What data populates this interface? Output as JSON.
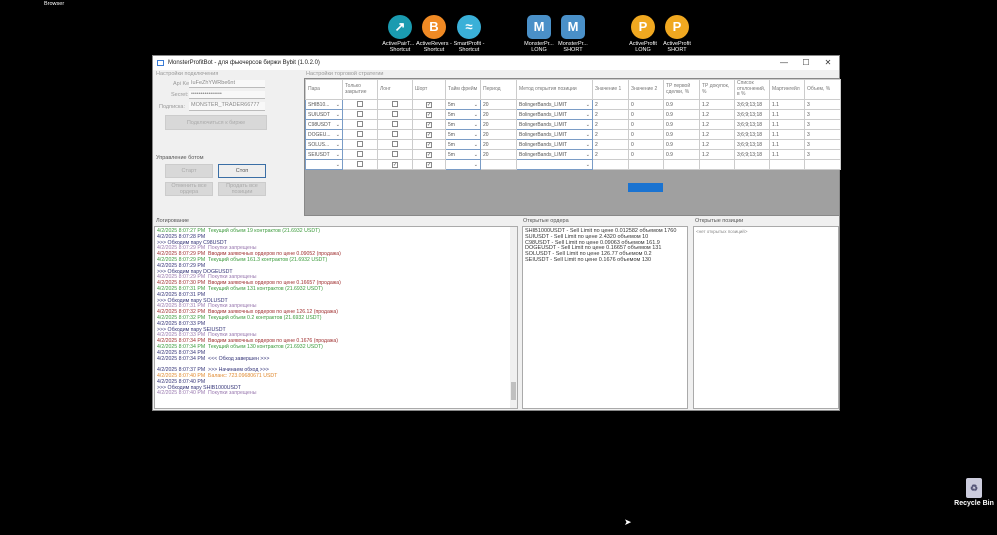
{
  "desktop": {
    "browser_label": "Browser",
    "icons": [
      {
        "label": "ActivePairT... - Shortcut",
        "color": "#1a9bb0",
        "glyph": "↗"
      },
      {
        "label": "ActiveRevers - Shortcut",
        "color": "#f08a24",
        "glyph": "B"
      },
      {
        "label": "SmartProfit - Shortcut",
        "color": "#3ab0d8",
        "glyph": "≈"
      },
      {
        "label": "MonsterPr... LONG",
        "color": "#4a90c8",
        "glyph": "M"
      },
      {
        "label": "MonsterPr... SHORT",
        "color": "#4a90c8",
        "glyph": "M"
      },
      {
        "label": "ActiveProfit LONG",
        "color": "#f0a820",
        "glyph": "P"
      },
      {
        "label": "ActiveProfit SHORT",
        "color": "#f0a820",
        "glyph": "P"
      }
    ],
    "recycle_bin": "Recycle Bin"
  },
  "window": {
    "title": "MonsterProfitBot - для фьючерсов биржи Bybit (1.0.2.0)",
    "minimize": "—",
    "maximize": "☐",
    "close": "✕"
  },
  "connection": {
    "group": "Настройки подключения",
    "api_key_label": "Api Key:",
    "api_key": "IuFeZhYWRbe6nt",
    "secret_label": "Secret:",
    "secret": "••••••••••••••••",
    "subscription_label": "Подписка:",
    "subscription": "MONSTER_TRADER66777",
    "connect_button": "Подключиться к бирже"
  },
  "bot_control": {
    "group": "Управление ботом",
    "start": "Старт",
    "stop": "Стоп",
    "close_all": "Отменить все ордера",
    "sell_all": "Продать все позиции"
  },
  "strategy": {
    "group": "Настройки торговой стратегии",
    "columns": [
      "Пара",
      "Только закрытие",
      "Лонг",
      "Шорт",
      "Тайм фрейм",
      "Период",
      "Метод открытия позиции",
      "Значение 1",
      "Значение 2",
      "TP первой сделки, %",
      "TP докупок, %",
      "Список отклонений, в %",
      "Мартингейл",
      "Объем, %"
    ],
    "rows": [
      {
        "pair": "SHIB10...",
        "close_only": false,
        "long": false,
        "short": true,
        "tf": "5m",
        "period": "20",
        "method": "BolingerBands_LIMIT",
        "v1": "2",
        "v2": "0",
        "tp1": "0.9",
        "tp2": "1.2",
        "dev": "3;6;9;13;18",
        "mart": "1.1",
        "vol": "3"
      },
      {
        "pair": "SUIUSDT",
        "close_only": false,
        "long": false,
        "short": true,
        "tf": "5m",
        "period": "20",
        "method": "BolingerBands_LIMIT",
        "v1": "2",
        "v2": "0",
        "tp1": "0.9",
        "tp2": "1.2",
        "dev": "3;6;9;13;18",
        "mart": "1.1",
        "vol": "3"
      },
      {
        "pair": "C98USDT",
        "close_only": false,
        "long": false,
        "short": true,
        "tf": "5m",
        "period": "20",
        "method": "BolingerBands_LIMIT",
        "v1": "2",
        "v2": "0",
        "tp1": "0.9",
        "tp2": "1.2",
        "dev": "3;6;9;13;18",
        "mart": "1.1",
        "vol": "3"
      },
      {
        "pair": "DOGEU...",
        "close_only": false,
        "long": false,
        "short": true,
        "tf": "5m",
        "period": "20",
        "method": "BolingerBands_LIMIT",
        "v1": "2",
        "v2": "0",
        "tp1": "0.9",
        "tp2": "1.2",
        "dev": "3;6;9;13;18",
        "mart": "1.1",
        "vol": "3"
      },
      {
        "pair": "SOLUS...",
        "close_only": false,
        "long": false,
        "short": true,
        "tf": "5m",
        "period": "20",
        "method": "BolingerBands_LIMIT",
        "v1": "2",
        "v2": "0",
        "tp1": "0.9",
        "tp2": "1.2",
        "dev": "3;6;9;13;18",
        "mart": "1.1",
        "vol": "3"
      },
      {
        "pair": "SEIUSDT",
        "close_only": false,
        "long": false,
        "short": true,
        "tf": "5m",
        "period": "20",
        "method": "BolingerBands_LIMIT",
        "v1": "2",
        "v2": "0",
        "tp1": "0.9",
        "tp2": "1.2",
        "dev": "3;6;9;13;18",
        "mart": "1.1",
        "vol": "3"
      },
      {
        "pair": "",
        "close_only": false,
        "long": true,
        "short": true,
        "tf": "",
        "period": "",
        "method": "",
        "v1": "",
        "v2": "",
        "tp1": "",
        "tp2": "",
        "dev": "",
        "mart": "",
        "vol": ""
      }
    ]
  },
  "log": {
    "label": "Логирование",
    "lines": [
      {
        "t": "4/2/2025 8:07:27 PM  Текущий объем 19 контрактов (21.6932 USDT)",
        "c": "#3a9a3a"
      },
      {
        "t": "4/2/2025 8:07:28 PM",
        "c": "#333377"
      },
      {
        "t": ">>> Обходим пару C98USDT",
        "c": "#333377"
      },
      {
        "t": "4/2/2025 8:07:29 PM  Покупки запрещены",
        "c": "#9a7ab0"
      },
      {
        "t": "4/2/2025 8:07:29 PM  Вводим заявочных ордеров по цене 0.09052 (продажа)",
        "c": "#a03030"
      },
      {
        "t": "4/2/2025 8:07:29 PM  Текущий объем 161.3 контрактов (21.6932 USDT)",
        "c": "#3a9a3a"
      },
      {
        "t": "4/2/2025 8:07:29 PM",
        "c": "#333377"
      },
      {
        "t": ">>> Обходим пару DOGEUSDT",
        "c": "#333377"
      },
      {
        "t": "4/2/2025 8:07:29 PM  Покупки запрещены",
        "c": "#9a7ab0"
      },
      {
        "t": "4/2/2025 8:07:30 PM  Вводим заявочных ордеров по цене 0.16657 (продажа)",
        "c": "#a03030"
      },
      {
        "t": "4/2/2025 8:07:31 PM  Текущий объем 131 контрактов (21.6932 USDT)",
        "c": "#3a9a3a"
      },
      {
        "t": "4/2/2025 8:07:31 PM",
        "c": "#333377"
      },
      {
        "t": ">>> Обходим пару SOLUSDT",
        "c": "#333377"
      },
      {
        "t": "4/2/2025 8:07:31 PM  Покупки запрещены",
        "c": "#9a7ab0"
      },
      {
        "t": "4/2/2025 8:07:32 PM  Вводим заявочных ордеров по цене 126.12 (продажа)",
        "c": "#a03030"
      },
      {
        "t": "4/2/2025 8:07:32 PM  Текущий объем 0.2 контрактов (21.6932 USDT)",
        "c": "#3a9a3a"
      },
      {
        "t": "4/2/2025 8:07:33 PM",
        "c": "#333377"
      },
      {
        "t": ">>> Обходим пару SEIUSDT",
        "c": "#333377"
      },
      {
        "t": "4/2/2025 8:07:33 PM  Покупки запрещены",
        "c": "#9a7ab0"
      },
      {
        "t": "4/2/2025 8:07:34 PM  Вводим заявочных ордеров по цене 0.1676 (продажа)",
        "c": "#a03030"
      },
      {
        "t": "4/2/2025 8:07:34 PM  Текущий объем 130 контрактов (21.6932 USDT)",
        "c": "#3a9a3a"
      },
      {
        "t": "4/2/2025 8:07:34 PM",
        "c": "#333377"
      },
      {
        "t": "4/2/2025 8:07:34 PM  <<< Обход завершен >>>",
        "c": "#333377"
      },
      {
        "t": " ",
        "c": "#333"
      },
      {
        "t": "4/2/2025 8:07:37 PM  >>> Начинаем обход >>>",
        "c": "#333377"
      },
      {
        "t": "4/2/2025 8:07:40 PM  Баланс: 723.09680671 USDT",
        "c": "#e08a30"
      },
      {
        "t": "4/2/2025 8:07:40 PM",
        "c": "#333377"
      },
      {
        "t": ">>> Обходим пару SHIB1000USDT",
        "c": "#333377"
      },
      {
        "t": "4/2/2025 8:07:40 PM  Покупки запрещены",
        "c": "#9a7ab0"
      }
    ]
  },
  "orders": {
    "label": "Открытые ордера",
    "lines": [
      "SHIB1000USDT - Sell Limit по цене 0.012582 объемом 1760",
      "SUIUSDT - Sell Limit по цене 2.4320 объемом 10",
      "C98USDT - Sell Limit по цене 0.09063 объемом 161.9",
      "DOGEUSDT - Sell Limit по цене 0.16657 объемом 131",
      "SOLUSDT - Sell Limit по цене 126.77 объемом 0.2",
      "SEIUSDT - Sell Limit по цене 0.1676 объемом 130"
    ]
  },
  "positions": {
    "label": "Открытые позиции",
    "text": "<нет открытых позиций>"
  }
}
